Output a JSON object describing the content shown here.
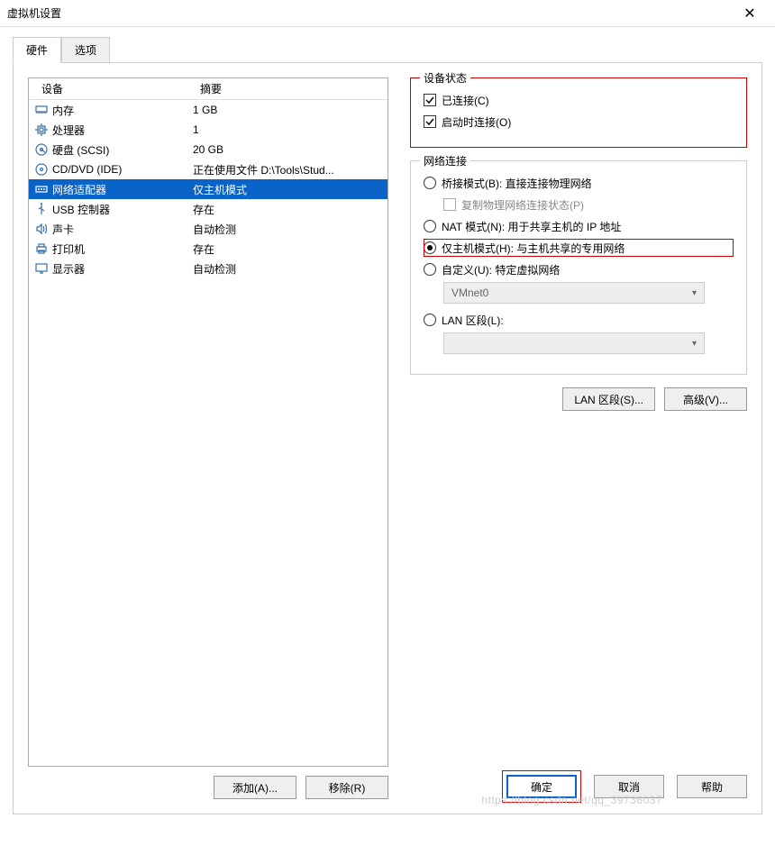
{
  "window": {
    "title": "虚拟机设置"
  },
  "tabs": {
    "hardware": "硬件",
    "options": "选项"
  },
  "headers": {
    "device": "设备",
    "summary": "摘要"
  },
  "devices": [
    {
      "icon": "memory",
      "name": "内存",
      "summary": "1 GB",
      "selected": false
    },
    {
      "icon": "cpu",
      "name": "处理器",
      "summary": "1",
      "selected": false
    },
    {
      "icon": "hdd",
      "name": "硬盘 (SCSI)",
      "summary": "20 GB",
      "selected": false
    },
    {
      "icon": "cd",
      "name": "CD/DVD (IDE)",
      "summary": "正在使用文件 D:\\Tools\\Stud...",
      "selected": false
    },
    {
      "icon": "net",
      "name": "网络适配器",
      "summary": "仅主机模式",
      "selected": true
    },
    {
      "icon": "usb",
      "name": "USB 控制器",
      "summary": "存在",
      "selected": false
    },
    {
      "icon": "sound",
      "name": "声卡",
      "summary": "自动检测",
      "selected": false
    },
    {
      "icon": "printer",
      "name": "打印机",
      "summary": "存在",
      "selected": false
    },
    {
      "icon": "display",
      "name": "显示器",
      "summary": "自动检测",
      "selected": false
    }
  ],
  "left_buttons": {
    "add": "添加(A)...",
    "remove": "移除(R)"
  },
  "device_state": {
    "title": "设备状态",
    "connected": "已连接(C)",
    "connect_at_power_on": "启动时连接(O)"
  },
  "net": {
    "title": "网络连接",
    "bridged": "桥接模式(B): 直接连接物理网络",
    "replicate": "复制物理网络连接状态(P)",
    "nat": "NAT 模式(N): 用于共享主机的 IP 地址",
    "hostonly": "仅主机模式(H): 与主机共享的专用网络",
    "custom": "自定义(U): 特定虚拟网络",
    "custom_value": "VMnet0",
    "lansegment": "LAN 区段(L):",
    "lansegment_value": ""
  },
  "right_buttons": {
    "lan": "LAN 区段(S)...",
    "advanced": "高级(V)..."
  },
  "footer": {
    "ok": "确定",
    "cancel": "取消",
    "help": "帮助"
  },
  "watermark": "https://blog.csdn.net/qq_39736037"
}
